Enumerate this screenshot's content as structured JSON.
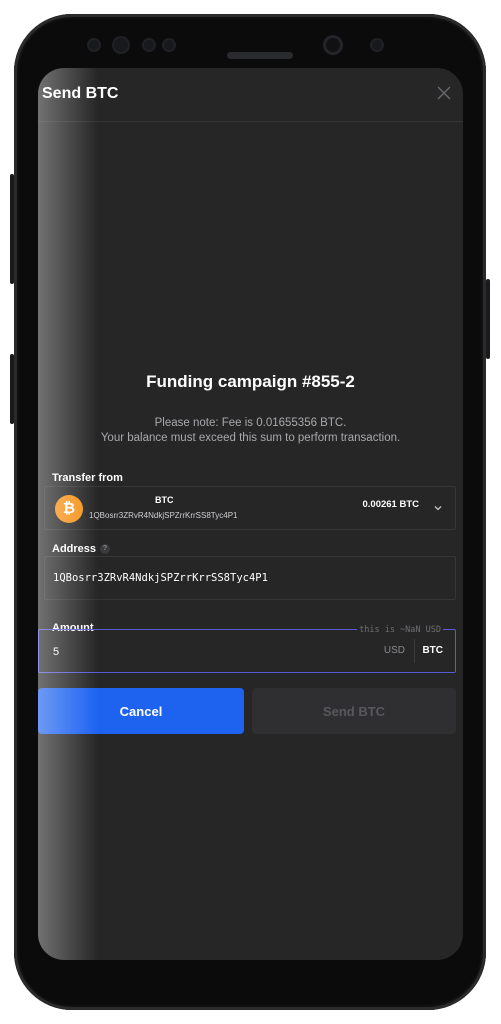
{
  "header": {
    "title": "Send BTC",
    "close_icon": "close-icon"
  },
  "campaign": {
    "title": "Funding campaign #855-2",
    "note_line1": "Please note: Fee is 0.01655356 BTC.",
    "note_line2": "Your balance must exceed this sum to perform transaction."
  },
  "transfer_from": {
    "label": "Transfer from",
    "coin_icon": "bitcoin-icon",
    "coin_symbol": "₿",
    "coin": "BTC",
    "address": "1QBosrr3ZRvR4NdkjSPZrrKrrSS8Tyc4P1",
    "balance": "0.00261 BTC"
  },
  "address_field": {
    "label": "Address",
    "help": "?",
    "value": "1QBosrr3ZRvR4NdkjSPZrrKrrSS8Tyc4P1"
  },
  "amount_field": {
    "label": "Amount",
    "hint": "this is ~NaN USD",
    "value": "5",
    "unit_usd": "USD",
    "unit_btc": "BTC"
  },
  "buttons": {
    "cancel": "Cancel",
    "send": "Send BTC"
  },
  "colors": {
    "accent": "#1e63f0",
    "focus_border": "#5a5ad6",
    "bitcoin": "#f7931a"
  }
}
